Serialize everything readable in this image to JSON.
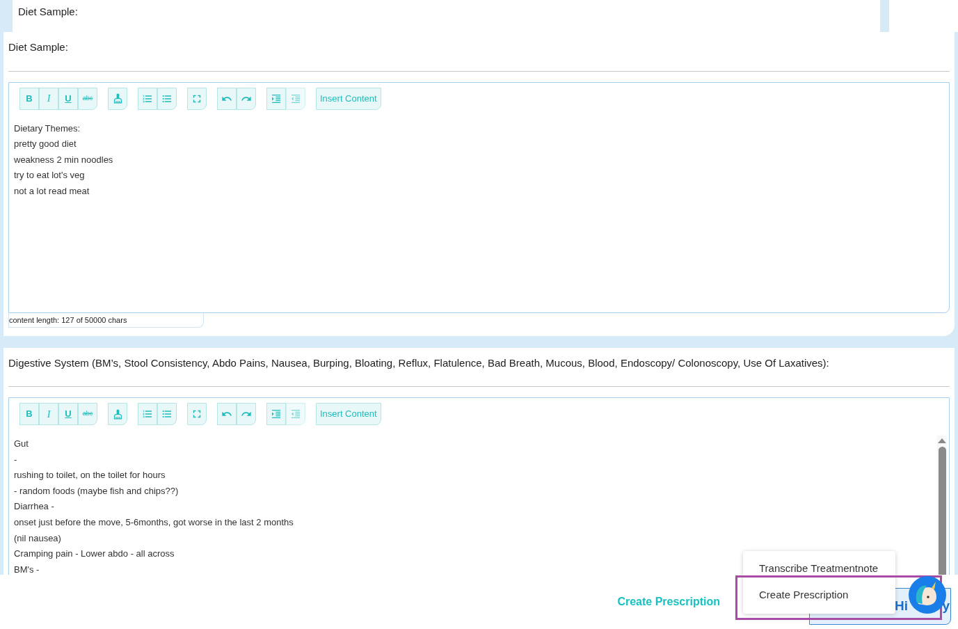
{
  "header": {
    "title": "Diet Sample:"
  },
  "sections": [
    {
      "title": "Diet Sample:",
      "format_buttons": [
        "B",
        "I",
        "U",
        "abc"
      ],
      "insert_button": "Insert Content",
      "lines": [
        "Dietary Themes:",
        "pretty good diet",
        "weakness 2 min noodles",
        "try to eat lot's veg",
        "not a lot read meat"
      ],
      "content_length": "content length: 127 of 50000 chars",
      "scrollbar": false
    },
    {
      "title": "Digestive System (BM’s, Stool Consistency, Abdo Pains, Nausea, Burping, Bloating, Reflux, Flatulence, Bad Breath, Mucous, Blood, Endoscopy/ Colonoscopy, Use Of Laxatives):",
      "format_buttons": [
        "B",
        "I",
        "U",
        "abc"
      ],
      "insert_button": "Insert Content",
      "lines": [
        "Gut",
        "-",
        "rushing to toilet, on the toilet for hours",
        "- random foods (maybe fish and chips??)",
        "Diarrhea -",
        "onset just before the move, 5-6months, got worse in the last 2 months",
        "(nil nausea)",
        "Cramping pain - Lower abdo - all across",
        "BM's -"
      ],
      "scrollbar": true
    }
  ],
  "footer": {
    "link": "Create Prescription",
    "history_button_parts": [
      "Hi",
      "y"
    ]
  },
  "menu": {
    "items": [
      {
        "label": "Transcribe Treatmentnote"
      },
      {
        "label": "Create Prescription"
      }
    ]
  }
}
